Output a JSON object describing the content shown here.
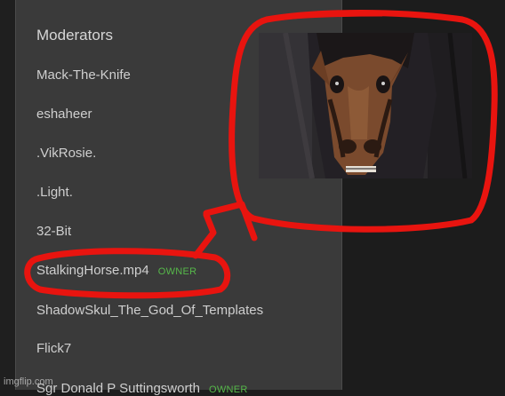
{
  "moderators_panel": {
    "title": "Moderators",
    "items": [
      {
        "name": "Mack-The-Knife",
        "badge": ""
      },
      {
        "name": "eshaheer",
        "badge": ""
      },
      {
        "name": ".VikRosie.",
        "badge": ""
      },
      {
        "name": ".Light.",
        "badge": ""
      },
      {
        "name": "32-Bit",
        "badge": ""
      },
      {
        "name": "StalkingHorse.mp4",
        "badge": "OWNER"
      },
      {
        "name": "ShadowSkul_The_God_Of_Templates",
        "badge": ""
      },
      {
        "name": "Flick7",
        "badge": ""
      },
      {
        "name": "Sgr Donald P Suttingsworth",
        "badge": "OWNER"
      }
    ]
  },
  "colors": {
    "panel_bg": "#3a3a3a",
    "page_bg": "#1d1d1d",
    "text": "#cfcfcf",
    "owner_badge": "#56b84a",
    "annotation": "#e8140f"
  },
  "image": {
    "subject": "anime-horse-face"
  },
  "watermark": "imgflip.com"
}
